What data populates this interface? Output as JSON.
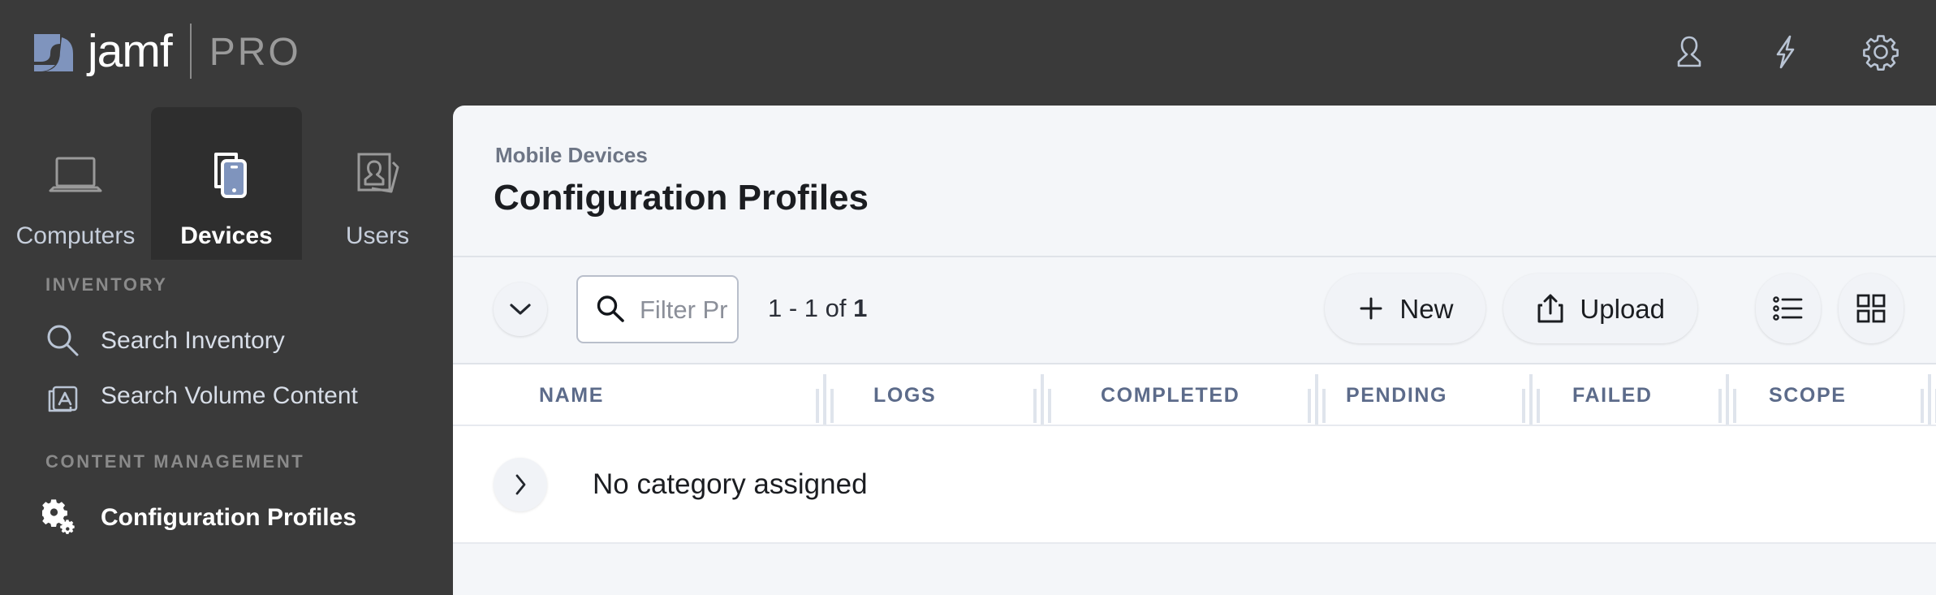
{
  "brand": {
    "name": "jamf",
    "product": "PRO"
  },
  "header": {
    "icons": [
      {
        "name": "user-account-icon",
        "label": "User"
      },
      {
        "name": "lightning-bolt-icon",
        "label": "Activity"
      },
      {
        "name": "gear-settings-icon",
        "label": "Settings"
      }
    ]
  },
  "nav_tabs": [
    {
      "label": "Computers",
      "icon": "laptop-icon",
      "active": false
    },
    {
      "label": "Devices",
      "icon": "mobile-device-icon",
      "active": true
    },
    {
      "label": "Users",
      "icon": "user-cards-icon",
      "active": false
    }
  ],
  "sidebar": {
    "sections": [
      {
        "title": "INVENTORY",
        "items": [
          {
            "label": "Search Inventory",
            "icon": "magnifier-icon",
            "active": false
          },
          {
            "label": "Search Volume Content",
            "icon": "app-store-icon",
            "active": false
          }
        ]
      },
      {
        "title": "CONTENT MANAGEMENT",
        "items": [
          {
            "label": "Configuration Profiles",
            "icon": "gears-icon",
            "active": true
          }
        ]
      }
    ]
  },
  "content": {
    "breadcrumb": "Mobile Devices",
    "title": "Configuration Profiles"
  },
  "toolbar": {
    "collapse_toggle": "chevron-down-icon",
    "search_placeholder": "Filter Pr",
    "search_value": "",
    "counter_prefix": "1 - 1 of ",
    "counter_total": "1",
    "new_label": "New",
    "upload_label": "Upload",
    "list_view_icon": "list-view-icon",
    "grid_view_icon": "grid-view-icon"
  },
  "table": {
    "columns": [
      "NAME",
      "LOGS",
      "COMPLETED",
      "PENDING",
      "FAILED",
      "SCOPE"
    ],
    "rows": [
      {
        "expand_icon": "chevron-right-icon",
        "label": "No category assigned"
      }
    ]
  },
  "colors": {
    "chrome": "#3a3a3a",
    "tab_active": "#2e2e2e",
    "panel_bg": "#f4f6f9",
    "table_bg": "#ffffff",
    "accent_blue": "#7f94bd",
    "header_text": "#5c6b8a",
    "nav_text": "#c6cedb"
  }
}
